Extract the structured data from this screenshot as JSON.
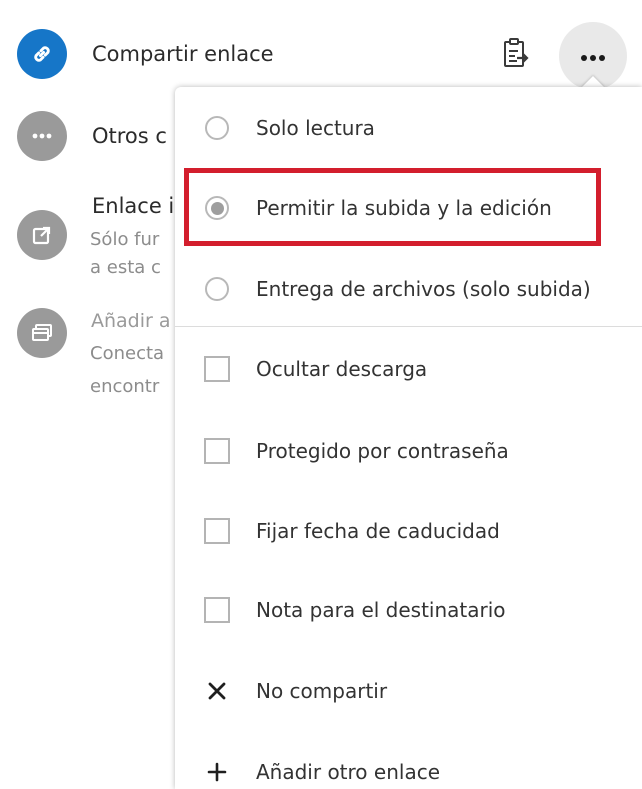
{
  "share_list": {
    "link_share": {
      "title": "Compartir enlace",
      "avatar_icon": "link-icon",
      "avatar_color": "#1676c8",
      "copy_icon": "clipboard-icon",
      "more_icon": "ellipsis-icon"
    },
    "other_methods": {
      "title": "Otros c",
      "avatar_icon": "ellipsis-icon"
    },
    "internal_link": {
      "title": "Enlace i",
      "sub_line1": "Sólo fur",
      "sub_line2": "a esta c",
      "avatar_icon": "external-link-icon"
    },
    "add_to": {
      "title": "Añadir a",
      "sub_line1": "Conecta",
      "sub_line2": "encontr",
      "avatar_icon": "window-icon"
    }
  },
  "menu": {
    "radio_options": [
      {
        "label": "Solo lectura",
        "selected": false
      },
      {
        "label": "Permitir la subida y la edición",
        "selected": true
      },
      {
        "label": "Entrega de archivos (solo subida)",
        "selected": false
      }
    ],
    "checkbox_options": [
      {
        "label": "Ocultar descarga",
        "checked": false
      },
      {
        "label": "Protegido por contraseña",
        "checked": false
      },
      {
        "label": "Fijar fecha de caducidad",
        "checked": false
      },
      {
        "label": "Nota para el destinatario",
        "checked": false
      }
    ],
    "actions": [
      {
        "label": "No compartir",
        "icon": "close-icon"
      },
      {
        "label": "Añadir otro enlace",
        "icon": "plus-icon"
      }
    ]
  },
  "colors": {
    "highlight": "#d31e2d",
    "accent": "#1676c8"
  }
}
